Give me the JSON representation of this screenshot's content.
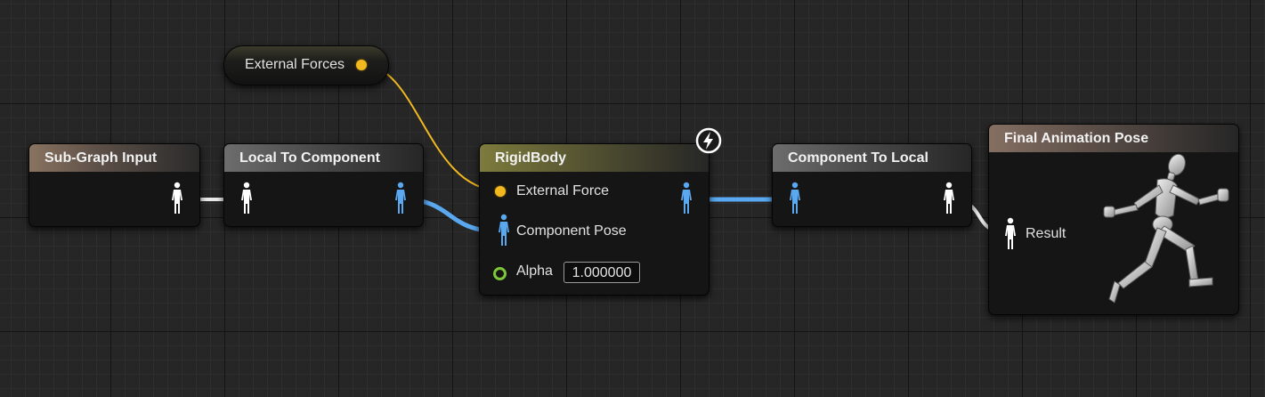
{
  "graph": {
    "nodes": {
      "external_forces_var": {
        "label": "External Forces"
      },
      "subgraph_input": {
        "title": "Sub-Graph Input"
      },
      "local_to_component": {
        "title": "Local To Component"
      },
      "rigidbody": {
        "title": "RigidBody",
        "pins": {
          "external_force": "External Force",
          "component_pose": "Component Pose",
          "alpha": "Alpha",
          "alpha_value": "1.000000"
        }
      },
      "component_to_local": {
        "title": "Component To Local"
      },
      "final_pose": {
        "title": "Final Animation Pose",
        "pins": {
          "result": "Result"
        }
      }
    }
  },
  "colors": {
    "pose_wire_white": "#ffffff",
    "pose_wire_blue": "#5aa8f0",
    "vector_wire": "#f1b820",
    "alpha_pin": "#7ec63a"
  },
  "icons": [
    "pose-white-icon",
    "pose-blue-icon",
    "lightning-icon",
    "mannequin-icon"
  ]
}
